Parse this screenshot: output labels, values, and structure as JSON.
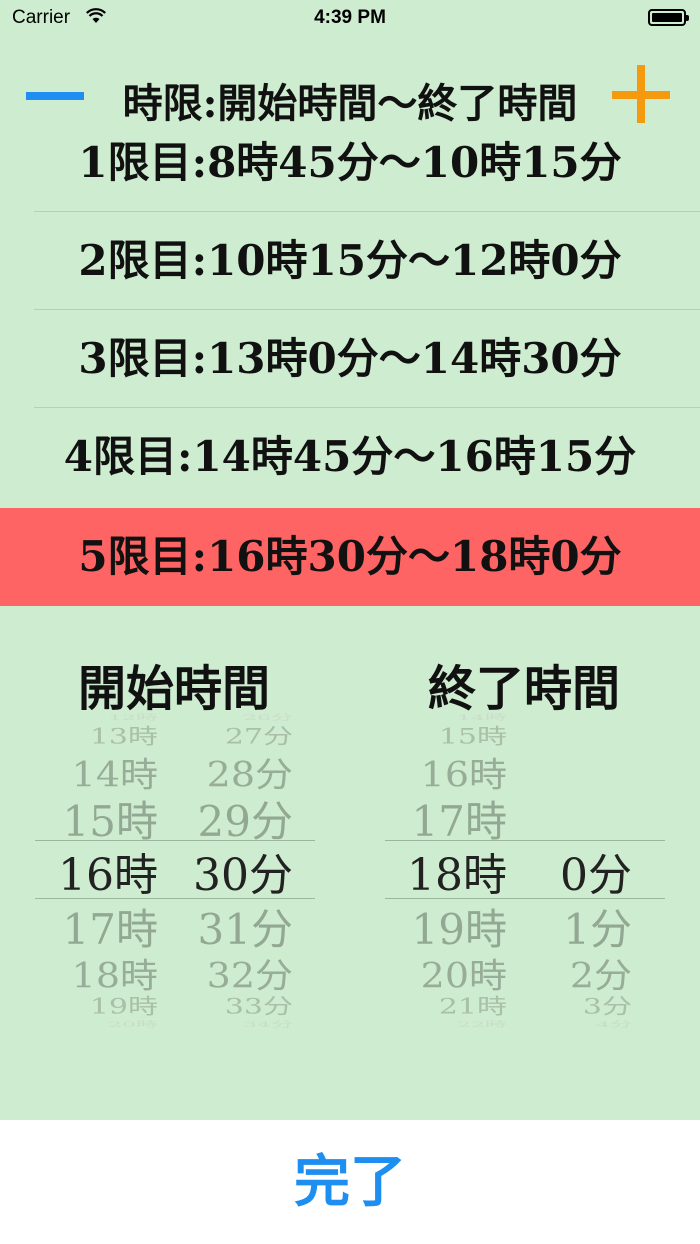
{
  "status_bar": {
    "carrier": "Carrier",
    "time": "4:39 PM"
  },
  "header": {
    "title": "時限:開始時間〜終了時間",
    "minus_icon": "minus-icon",
    "plus_icon": "plus-icon",
    "minus_color": "#1e8ef0",
    "plus_color": "#f59a0f"
  },
  "periods": [
    {
      "label": "1限目:8時45分〜10時15分"
    },
    {
      "label": "2限目:10時15分〜12時0分"
    },
    {
      "label": "3限目:13時0分〜14時30分"
    },
    {
      "label": "4限目:14時45分〜16時15分"
    },
    {
      "label": "5限目:16時30分〜18時0分",
      "selected": true
    }
  ],
  "picker": {
    "start": {
      "title": "開始時間",
      "hours": [
        "12時",
        "13時",
        "14時",
        "15時",
        "16時",
        "17時",
        "18時",
        "19時",
        "20時"
      ],
      "minutes": [
        "26分",
        "27分",
        "28分",
        "29分",
        "30分",
        "31分",
        "32分",
        "33分",
        "34分"
      ],
      "selected_hour": "16時",
      "selected_minute": "30分"
    },
    "end": {
      "title": "終了時間",
      "hours": [
        "14時",
        "15時",
        "16時",
        "17時",
        "18時",
        "19時",
        "20時",
        "21時",
        "22時"
      ],
      "minutes": [
        "",
        "",
        "",
        "",
        "0分",
        "1分",
        "2分",
        "3分",
        "4分"
      ],
      "selected_hour": "18時",
      "selected_minute": "0分"
    }
  },
  "footer": {
    "done_label": "完了"
  },
  "colors": {
    "background": "#ceeccf",
    "selected_row": "#fe6464",
    "done": "#1e8ef0"
  }
}
